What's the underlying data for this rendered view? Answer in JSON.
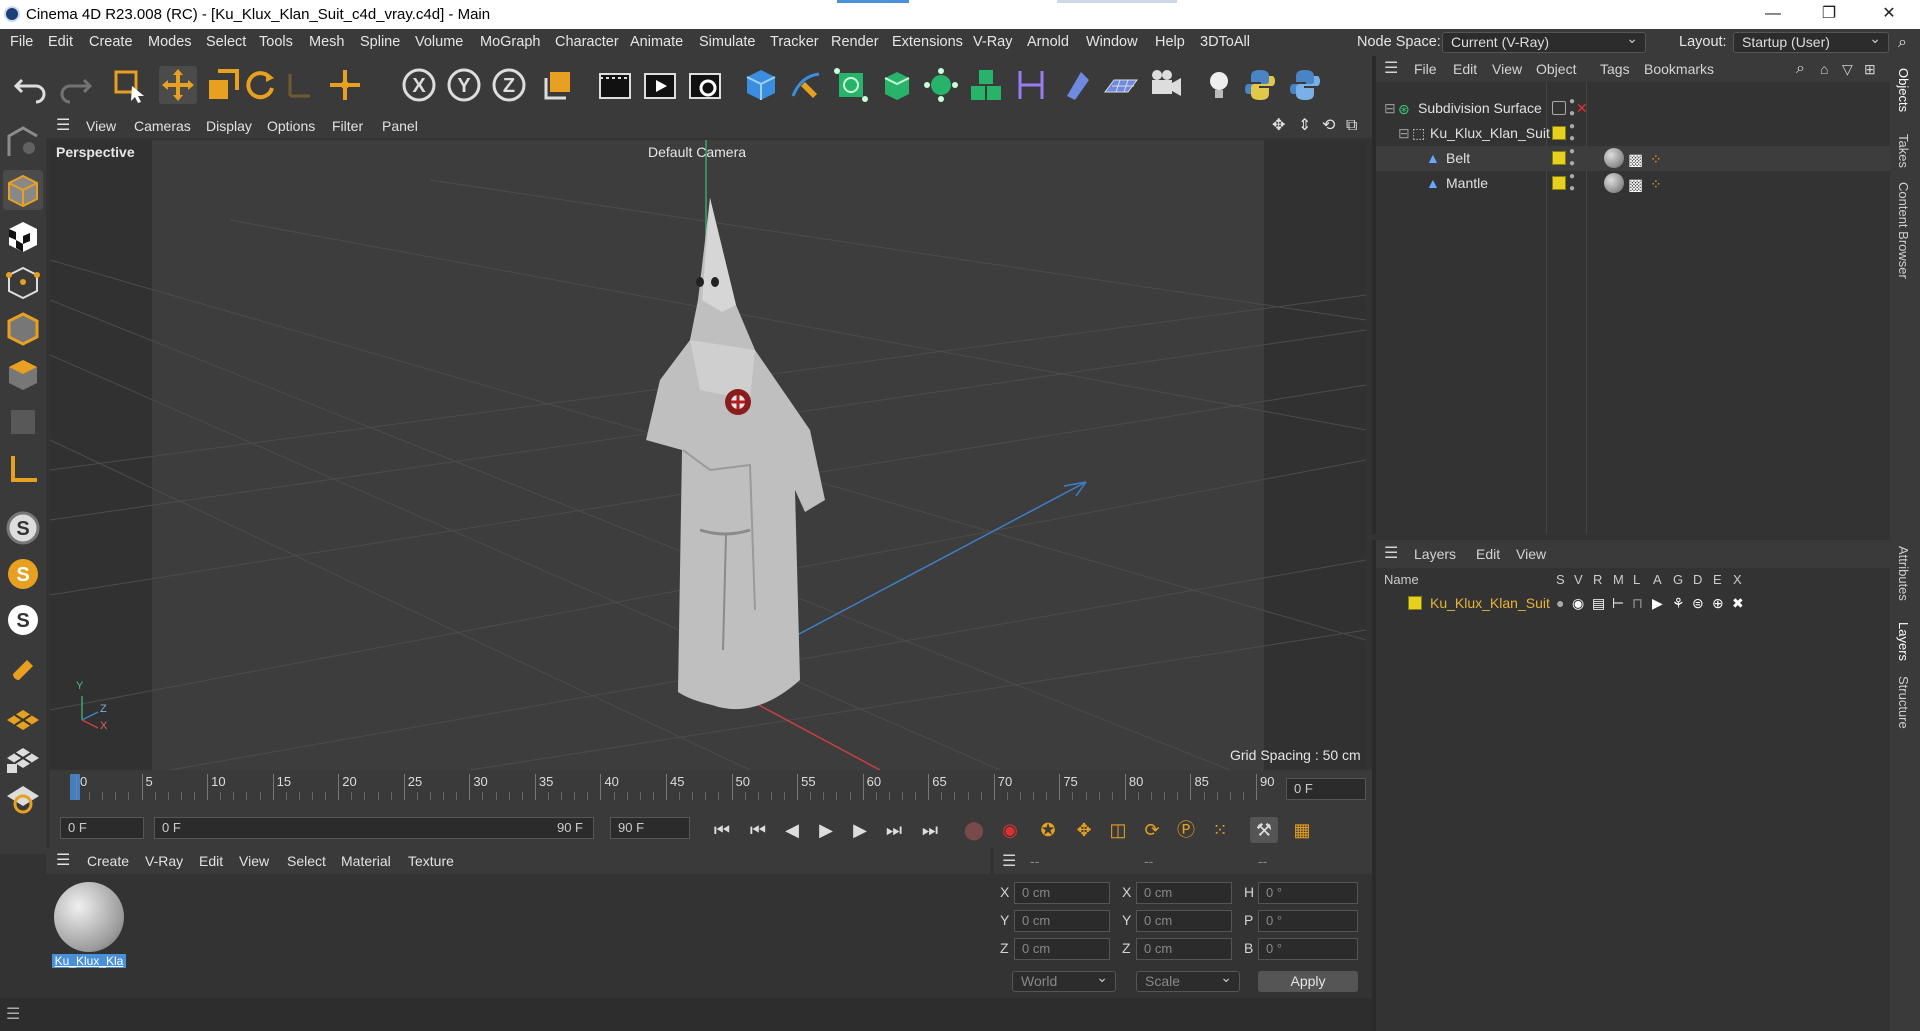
{
  "window": {
    "title": "Cinema 4D R23.008 (RC) - [Ku_Klux_Klan_Suit_c4d_vray.c4d] - Main",
    "min": "—",
    "max": "❐",
    "close": "✕"
  },
  "menu": [
    "File",
    "Edit",
    "Create",
    "Modes",
    "Select",
    "Tools",
    "Mesh",
    "Spline",
    "Volume",
    "MoGraph",
    "Character",
    "Animate",
    "Simulate",
    "Tracker",
    "Render",
    "Extensions",
    "V-Ray",
    "Arnold",
    "Window",
    "Help",
    "3DToAll"
  ],
  "node_space": {
    "label": "Node Space:",
    "value": "Current (V-Ray)"
  },
  "layout": {
    "label": "Layout:",
    "value": "Startup (User)"
  },
  "viewport": {
    "menu": [
      "View",
      "Cameras",
      "Display",
      "Options",
      "Filter",
      "Panel"
    ],
    "name": "Perspective",
    "camera": "Default Camera",
    "grid_spacing": "Grid Spacing : 50 cm",
    "axis_y": "Y",
    "axis_z": "Z",
    "axis_x": "X"
  },
  "timeline": {
    "ticks": [
      "0",
      "5",
      "10",
      "15",
      "20",
      "25",
      "30",
      "35",
      "40",
      "45",
      "50",
      "55",
      "60",
      "65",
      "70",
      "75",
      "80",
      "85",
      "90"
    ],
    "current": "0 F"
  },
  "transport": {
    "start": "0 F",
    "range_start": "0 F",
    "range_end": "90 F",
    "end": "90 F"
  },
  "material_manager": {
    "menu": [
      "Create",
      "V-Ray",
      "Edit",
      "View",
      "Select",
      "Material",
      "Texture"
    ],
    "material_name": "Ku_Klux_Kla"
  },
  "coords": {
    "headers": [
      "--",
      "--",
      "--"
    ],
    "rows": [
      {
        "a": "X",
        "v1": "0 cm",
        "b": "X",
        "v2": "0 cm",
        "c": "H",
        "v3": "0 °"
      },
      {
        "a": "Y",
        "v1": "0 cm",
        "b": "Y",
        "v2": "0 cm",
        "c": "P",
        "v3": "0 °"
      },
      {
        "a": "Z",
        "v1": "0 cm",
        "b": "Z",
        "v2": "0 cm",
        "c": "B",
        "v3": "0 °"
      }
    ],
    "mode": "World",
    "transform": "Scale",
    "apply": "Apply"
  },
  "objects": {
    "menu": [
      "File",
      "Edit",
      "View",
      "Object",
      "Tags",
      "Bookmarks"
    ],
    "items": [
      {
        "name": "Subdivision Surface"
      },
      {
        "name": "Ku_Klux_Klan_Suit"
      },
      {
        "name": "Belt"
      },
      {
        "name": "Mantle"
      }
    ]
  },
  "layers": {
    "menu": [
      "Layers",
      "Edit",
      "View"
    ],
    "columns": [
      "Name",
      "S",
      "V",
      "R",
      "M",
      "L",
      "A",
      "G",
      "D",
      "E",
      "X"
    ],
    "items": [
      {
        "name": "Ku_Klux_Klan_Suit"
      }
    ]
  },
  "side_tabs": [
    "Objects",
    "Takes",
    "Content Browser",
    "Attributes",
    "Layers",
    "Structure"
  ],
  "colors": {
    "accent": "#e6d21e",
    "selection": "#4a90d9",
    "layer_text": "#e8b33a"
  }
}
